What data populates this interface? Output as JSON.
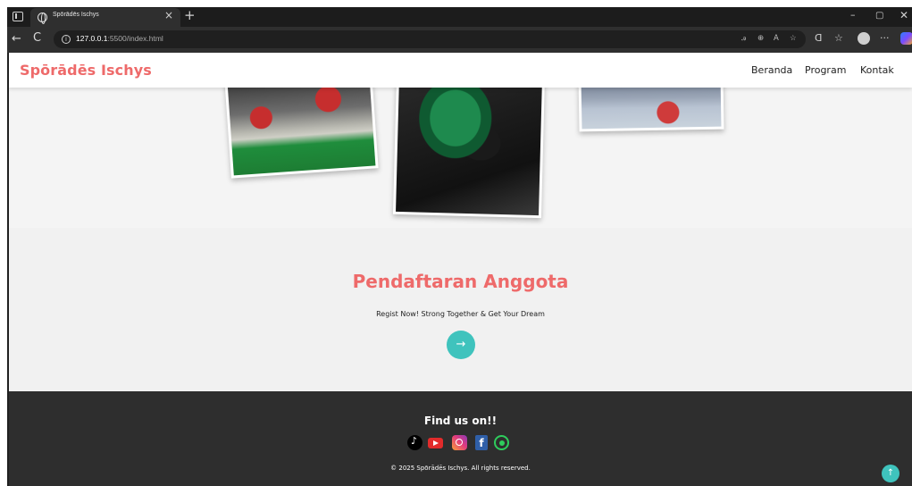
{
  "browser": {
    "tab_title": "Spōrādēs Ischys",
    "tab_close": "×",
    "new_tab": "+",
    "url_host": "127.0.0.1",
    "url_path": ":5500/index.html",
    "window_min": "–",
    "window_max": "▢",
    "window_close": "✕",
    "nav_back": "←",
    "nav_reload": "C"
  },
  "header": {
    "brand": "Spōrādēs Ischys",
    "nav": [
      "Beranda",
      "Program",
      "Kontak"
    ]
  },
  "gallery": {
    "photos": [
      "deadlift-platform-photo",
      "weight-plates-photo",
      "competition-lift-photo"
    ]
  },
  "register": {
    "title": "Pendaftaran Anggota",
    "subtitle": "Regist Now! Strong Together & Get Your Dream",
    "button_arrow": "→"
  },
  "footer": {
    "find_us": "Find us on!!",
    "socials": [
      "tiktok-icon",
      "youtube-icon",
      "instagram-icon",
      "facebook-icon",
      "whatsapp-icon"
    ],
    "facebook_glyph": "f",
    "copyright": "© 2025 Spōrādēs Ischys. All rights reserved.",
    "back_to_top": "↑"
  },
  "colors": {
    "brand_accent": "#ee6a6a",
    "button_teal": "#3fc3bd",
    "footer_bg": "#2e2e2e"
  }
}
